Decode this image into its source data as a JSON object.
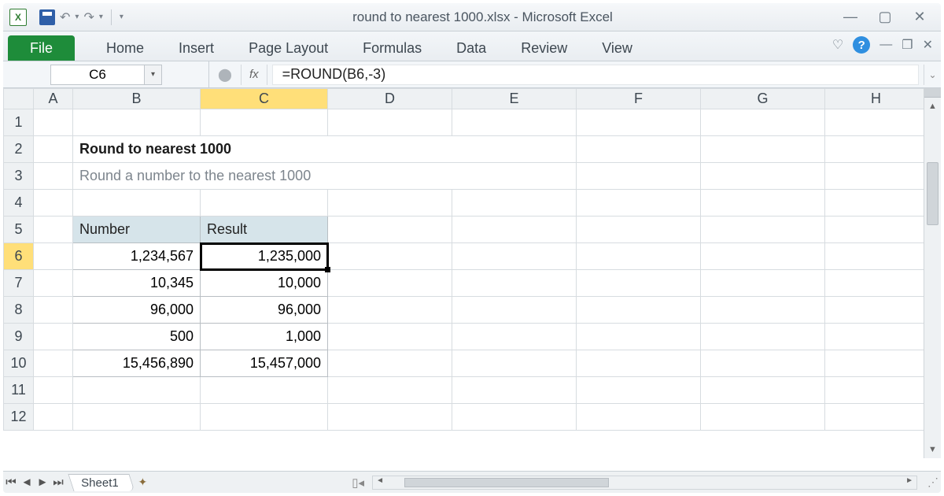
{
  "window": {
    "title": "round to nearest 1000.xlsx  -  Microsoft Excel"
  },
  "ribbon": {
    "file": "File",
    "tabs": [
      "Home",
      "Insert",
      "Page Layout",
      "Formulas",
      "Data",
      "Review",
      "View"
    ]
  },
  "namebox": {
    "value": "C6"
  },
  "formula_bar": {
    "fx": "fx",
    "value": "=ROUND(B6,-3)"
  },
  "columns": [
    "A",
    "B",
    "C",
    "D",
    "E",
    "F",
    "G",
    "H"
  ],
  "rows": [
    "1",
    "2",
    "3",
    "4",
    "5",
    "6",
    "7",
    "8",
    "9",
    "10",
    "11",
    "12"
  ],
  "content": {
    "title": "Round to nearest 1000",
    "subtitle": "Round a number to the nearest 1000",
    "headers": {
      "number": "Number",
      "result": "Result"
    },
    "data": [
      {
        "number": "1,234,567",
        "result": "1,235,000"
      },
      {
        "number": "10,345",
        "result": "10,000"
      },
      {
        "number": "96,000",
        "result": "96,000"
      },
      {
        "number": "500",
        "result": "1,000"
      },
      {
        "number": "15,456,890",
        "result": "15,457,000"
      }
    ]
  },
  "sheet_tabs": {
    "active": "Sheet1"
  },
  "active": {
    "col": "C",
    "row": "6"
  }
}
